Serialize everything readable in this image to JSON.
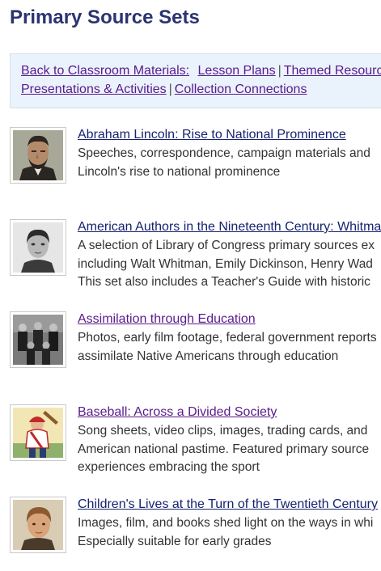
{
  "page": {
    "title": "Primary Source Sets"
  },
  "nav": {
    "line1": [
      {
        "label": "Back to Classroom Materials:"
      },
      {
        "label": "Lesson Plans"
      },
      {
        "label": "Themed Resources"
      }
    ],
    "line2": [
      {
        "label": "Presentations & Activities"
      },
      {
        "label": "Collection Connections"
      }
    ],
    "separator": "|"
  },
  "items": [
    {
      "title": "Abraham Lincoln: Rise to National Prominence",
      "desc": [
        "Speeches, correspondence, campaign materials and",
        "Lincoln's rise to national prominence"
      ],
      "thumb_icon": "lincoln-portrait-icon"
    },
    {
      "title": "American Authors in the Nineteenth Century: Whitman",
      "desc": [
        "A selection of Library of Congress primary sources ex",
        "including Walt Whitman, Emily Dickinson, Henry Wad",
        "This set also includes a Teacher's Guide with historic"
      ],
      "thumb_icon": "author-portrait-icon"
    },
    {
      "title": "Assimilation through Education",
      "desc": [
        "Photos, early film footage, federal government reports",
        "assimilate Native Americans through education"
      ],
      "thumb_icon": "group-photo-icon"
    },
    {
      "title": "Baseball: Across a Divided Society",
      "desc": [
        "Song sheets, video clips, images, trading cards, and",
        "American national pastime. Featured primary source",
        "experiences embracing the sport"
      ],
      "thumb_icon": "baseball-player-icon"
    },
    {
      "title": "Children's Lives at the Turn of the Twentieth Century",
      "desc": [
        "Images, film, and books shed light on the ways in whi",
        "Especially suitable for early grades"
      ],
      "thumb_icon": "child-portrait-icon"
    }
  ]
}
